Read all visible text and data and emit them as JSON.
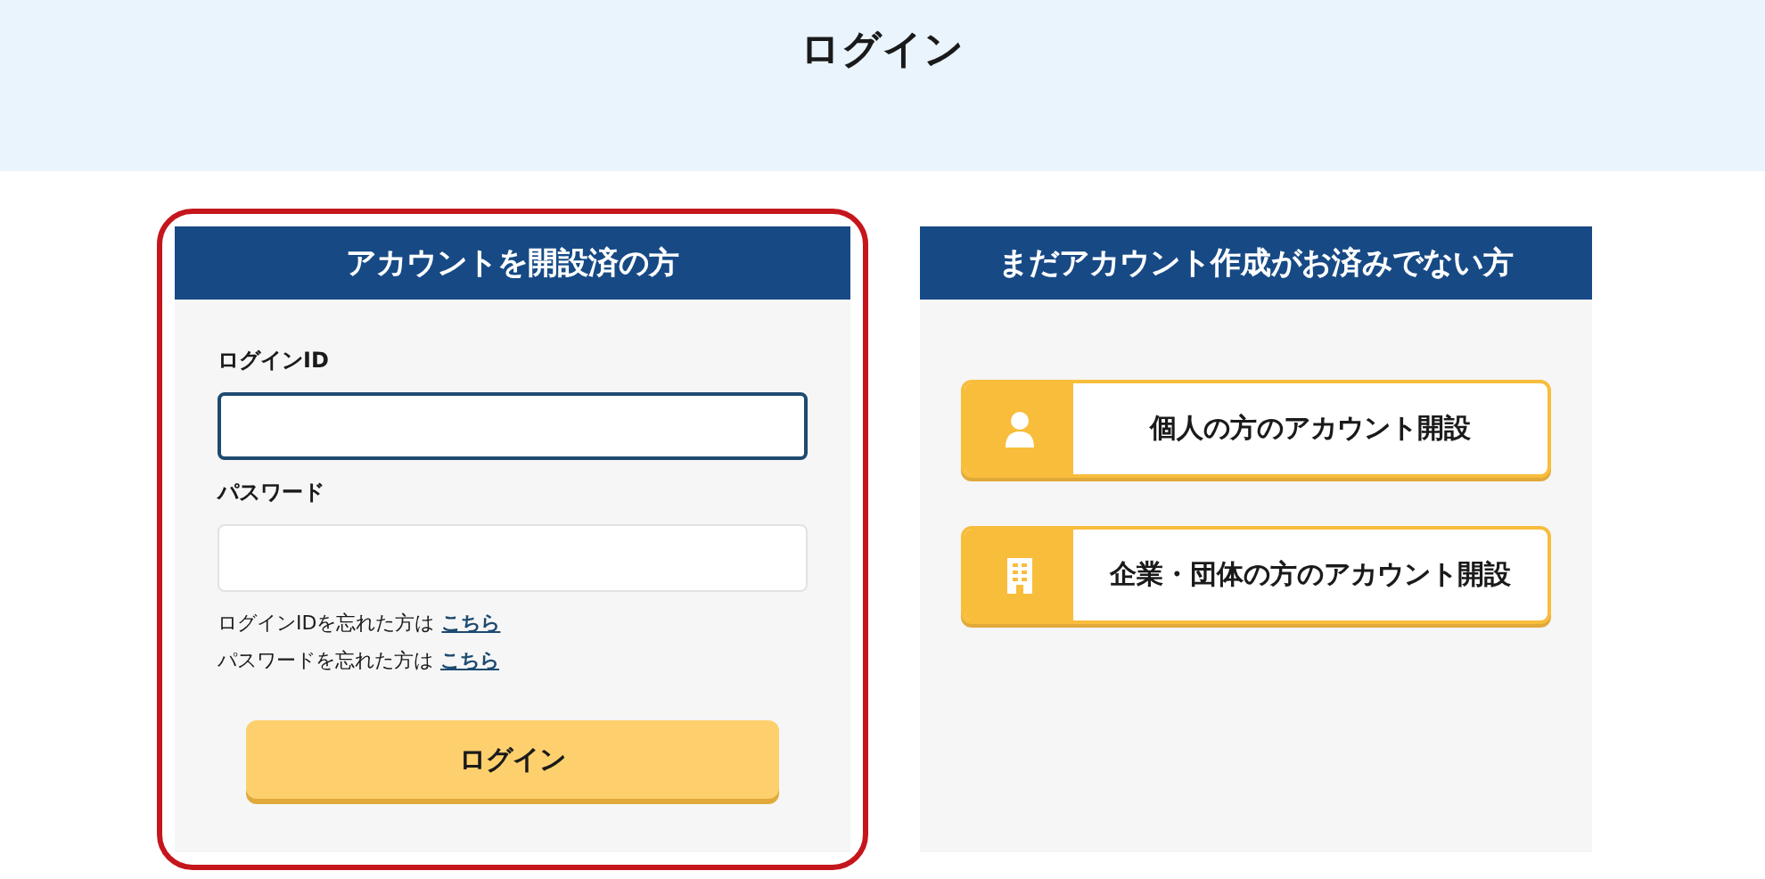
{
  "page_title": "ログイン",
  "login_card": {
    "title": "アカウントを開設済の方",
    "highlighted": true,
    "fields": [
      {
        "label": "ログインID",
        "focused": true
      },
      {
        "label": "パスワード",
        "focused": false
      }
    ],
    "help_links": [
      {
        "text": "ログインIDを忘れた方は",
        "link": "こちら"
      },
      {
        "text": "パスワードを忘れた方は",
        "link": "こちら"
      }
    ],
    "button": "ログイン"
  },
  "signup_card": {
    "title": "まだアカウント作成がお済みでない方",
    "options": [
      {
        "kind": "person",
        "label": "個人の方のアカウント開設"
      },
      {
        "kind": "building",
        "label": "企業・団体の方のアカウント開設"
      }
    ]
  }
}
